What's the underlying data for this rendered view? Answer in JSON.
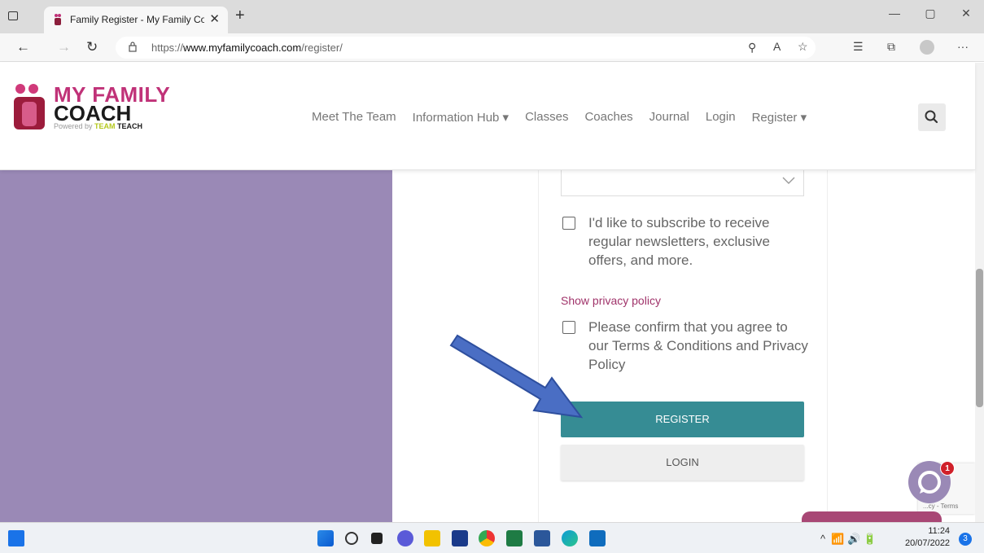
{
  "browser": {
    "tab_title": "Family Register - My Family Coac",
    "tab_close": "✕",
    "new_tab": "+",
    "url_prefix": "https://",
    "url_host": "www.myfamilycoach.com",
    "url_path": "/register/",
    "window_controls": [
      "—",
      "▢",
      "✕"
    ]
  },
  "site": {
    "logo_line1": "MY FAMILY",
    "logo_line2": "COACH",
    "powered_prefix": "Powered by ",
    "powered_team": "TEAM",
    "powered_teach": " TEACH",
    "brand_pink": "#c03278",
    "nav": [
      {
        "label": "Meet The Team"
      },
      {
        "label": "Information Hub ▾"
      },
      {
        "label": "Classes"
      },
      {
        "label": "Coaches"
      },
      {
        "label": "Journal"
      },
      {
        "label": "Login"
      },
      {
        "label": "Register ▾"
      }
    ]
  },
  "form": {
    "newsletter_label": "I'd like to subscribe to receive regular newsletters, exclusive offers, and more.",
    "privacy_link": "Show privacy policy",
    "terms_label": "Please confirm that you agree to our Terms & Conditions and Privacy Policy",
    "register_label": "REGISTER",
    "login_label": "LOGIN",
    "register_color": "#368c94"
  },
  "widgets": {
    "chat_badge": "1",
    "recaptcha_text": "...cy - Terms"
  },
  "taskbar": {
    "time": "11:24",
    "date": "20/07/2022",
    "notifications": "3"
  }
}
